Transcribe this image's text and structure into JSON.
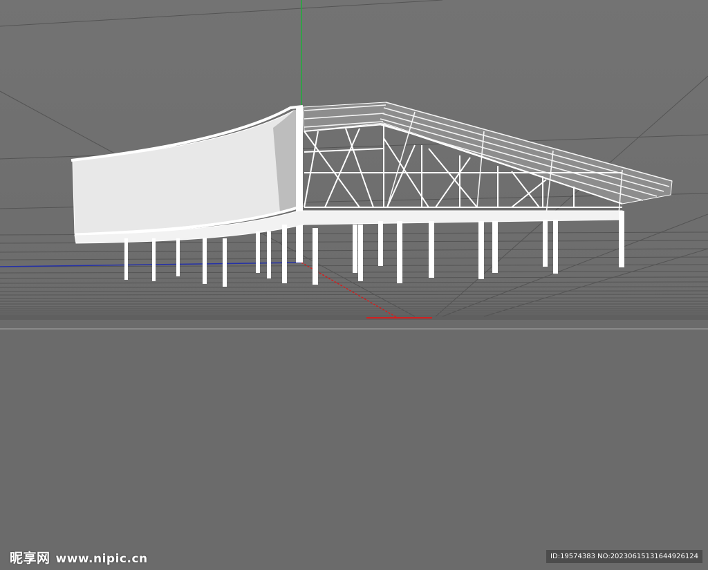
{
  "viewport": {
    "background_color": "#6e6e6e",
    "floor_color": "#6b6b6b",
    "grid_line_color": "#4a4a4a",
    "horizon_line_color": "#8a8a8a",
    "model_color": "#ffffff"
  },
  "axes": {
    "x_axis_color": "#d12020",
    "y_axis_color": "#1fae3a",
    "z_axis_color": "#2430a8"
  },
  "watermark": {
    "brand_cn": "昵享网",
    "site": "www.nipic.cn",
    "image_info": "ID:19574383 NO:20230615131644926124"
  }
}
